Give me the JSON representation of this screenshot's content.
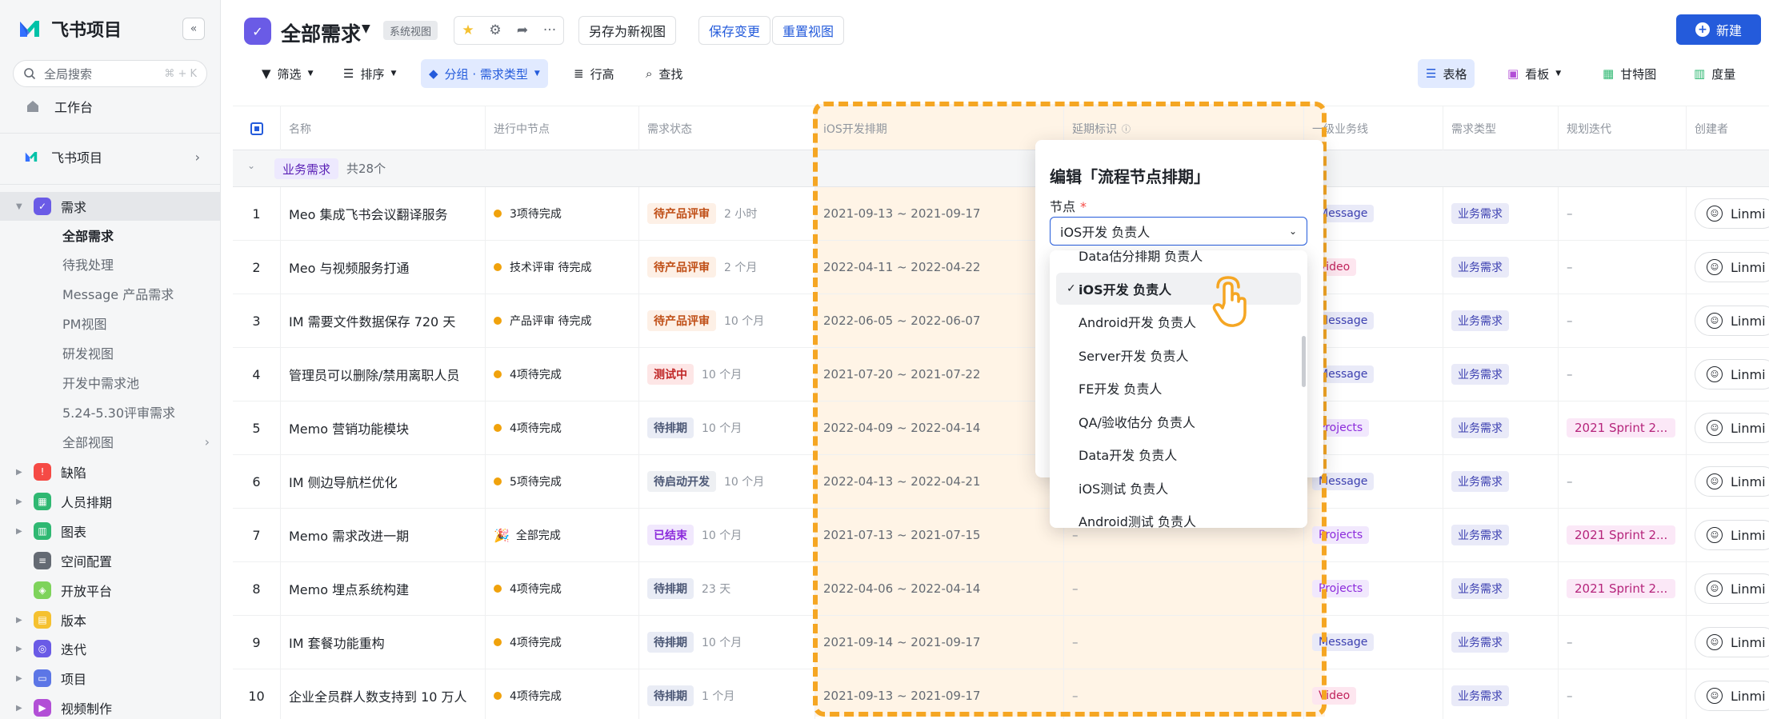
{
  "sidebar": {
    "app_name": "飞书项目",
    "search_placeholder": "全局搜索",
    "search_shortcut": "⌘ + K",
    "workspace": "工作台",
    "project": "飞书项目",
    "nav_items": [
      {
        "label": "需求",
        "color": "#6a5be6",
        "expanded": true
      },
      {
        "label": "缺陷",
        "color": "#f54a45"
      },
      {
        "label": "人员排期",
        "color": "#2fb872"
      },
      {
        "label": "图表",
        "color": "#2fb872"
      },
      {
        "label": "空间配置",
        "color": "#646a73"
      },
      {
        "label": "开放平台",
        "color": "#7ed35b"
      },
      {
        "label": "版本",
        "color": "#f5c130"
      },
      {
        "label": "迭代",
        "color": "#6a5be6"
      },
      {
        "label": "项目",
        "color": "#5c76e6"
      },
      {
        "label": "视频制作",
        "color": "#b24fd6"
      }
    ],
    "sub_items": [
      "全部需求",
      "待我处理",
      "Message 产品需求",
      "PM视图",
      "研发视图",
      "开发中需求池",
      "5.24-5.30评审需求",
      "全部视图"
    ]
  },
  "header": {
    "title": "全部需求",
    "badge": "系统视图",
    "save_as": "另存为新视图",
    "save_changes": "保存变更",
    "reset": "重置视图",
    "new_button": "新建"
  },
  "toolbar": {
    "filter": "筛选",
    "sort": "排序",
    "group": "分组 · 需求类型",
    "row_height": "行高",
    "find": "查找",
    "view_table": "表格",
    "view_board": "看板",
    "view_gantt": "甘特图",
    "view_metric": "度量"
  },
  "table": {
    "columns": [
      "名称",
      "进行中节点",
      "需求状态",
      "iOS开发排期",
      "延期标识",
      "一级业务线",
      "需求类型",
      "规划迭代",
      "创建者"
    ],
    "group_label": "业务需求",
    "group_count": "共28个",
    "rows": [
      {
        "num": "1",
        "name": "Meo 集成飞书会议翻译服务",
        "node": "3项待完成",
        "status": "待产品评审",
        "status_color": "orange",
        "time": "2 小时",
        "ios": "2021-09-13 ~ 2021-09-17",
        "delay": "",
        "biz": "Message",
        "biz_color": "msg",
        "type": "业务需求",
        "sprint": "–",
        "creator": "Linmi"
      },
      {
        "num": "2",
        "name": "Meo 与视频服务打通",
        "node": "技术评审 待完成",
        "status": "待产品评审",
        "status_color": "orange",
        "time": "2 个月",
        "ios": "2022-04-11 ~ 2022-04-22",
        "delay": "",
        "biz": "Video",
        "biz_color": "video",
        "type": "业务需求",
        "sprint": "–",
        "creator": "Linmi"
      },
      {
        "num": "3",
        "name": "IM 需要文件数据保存 720 天",
        "node": "产品评审 待完成",
        "status": "待产品评审",
        "status_color": "orange",
        "time": "10 个月",
        "ios": "2022-06-05 ~ 2022-06-07",
        "delay": "",
        "biz": "Message",
        "biz_color": "msg",
        "type": "业务需求",
        "sprint": "–",
        "creator": "Linmi"
      },
      {
        "num": "4",
        "name": "管理员可以删除/禁用离职人员",
        "node": "4项待完成",
        "status": "测试中",
        "status_color": "red",
        "time": "10 个月",
        "ios": "2021-07-20 ~ 2021-07-22",
        "delay": "",
        "biz": "Message",
        "biz_color": "msg",
        "type": "业务需求",
        "sprint": "–",
        "creator": "Linmi"
      },
      {
        "num": "5",
        "name": "Memo 营销功能模块",
        "node": "4项待完成",
        "status": "待排期",
        "status_color": "blue",
        "time": "10 个月",
        "ios": "2022-04-09 ~ 2022-04-14",
        "delay": "",
        "biz": "Projects",
        "biz_color": "proj",
        "type": "业务需求",
        "sprint": "2021 Sprint 2...",
        "creator": "Linmi"
      },
      {
        "num": "6",
        "name": "IM 侧边导航栏优化",
        "node": "5项待完成",
        "status": "待启动开发",
        "status_color": "gray",
        "time": "10 个月",
        "ios": "2022-04-13 ~ 2022-04-21",
        "delay": "",
        "biz": "Message",
        "biz_color": "msg",
        "type": "业务需求",
        "sprint": "–",
        "creator": "Linmi"
      },
      {
        "num": "7",
        "name": "Memo 需求改进一期",
        "node": "全部完成",
        "node_done": true,
        "status": "已结束",
        "status_color": "purple",
        "time": "10 个月",
        "ios": "2021-07-13 ~ 2021-07-15",
        "delay": "–",
        "biz": "Projects",
        "biz_color": "proj",
        "type": "业务需求",
        "sprint": "2021 Sprint 2...",
        "creator": "Linmi"
      },
      {
        "num": "8",
        "name": "Memo 埋点系统构建",
        "node": "4项待完成",
        "status": "待排期",
        "status_color": "blue",
        "time": "23 天",
        "ios": "2022-04-06 ~ 2022-04-14",
        "delay": "–",
        "biz": "Projects",
        "biz_color": "proj",
        "type": "业务需求",
        "sprint": "2021 Sprint 2...",
        "creator": "Linmi"
      },
      {
        "num": "9",
        "name": "IM 套餐功能重构",
        "node": "4项待完成",
        "status": "待排期",
        "status_color": "blue",
        "time": "10 个月",
        "ios": "2021-09-14 ~ 2021-09-17",
        "delay": "–",
        "biz": "Message",
        "biz_color": "msg",
        "type": "业务需求",
        "sprint": "–",
        "creator": "Linmi"
      },
      {
        "num": "10",
        "name": "企业全员群人数支持到 10 万人",
        "node": "4项待完成",
        "status": "待排期",
        "status_color": "blue",
        "time": "1 个月",
        "ios": "2021-09-13 ~ 2021-09-17",
        "delay": "–",
        "biz": "Video",
        "biz_color": "video",
        "type": "业务需求",
        "sprint": "–",
        "creator": "Linmi"
      }
    ]
  },
  "popup": {
    "title": "编辑「流程节点排期」",
    "field_label": "节点",
    "required_mark": "*",
    "selected_value": "iOS开发 负责人",
    "options": [
      "Data估分排期 负责人",
      "iOS开发 负责人",
      "Android开发 负责人",
      "Server开发 负责人",
      "FE开发 负责人",
      "QA/验收估分 负责人",
      "Data开发 负责人",
      "iOS测试 负责人",
      "Android测试 负责人"
    ],
    "selected_index": 1
  },
  "colors": {
    "accent": "#245bdb",
    "highlight": "#f5a623",
    "brand": "#6a5be6"
  }
}
